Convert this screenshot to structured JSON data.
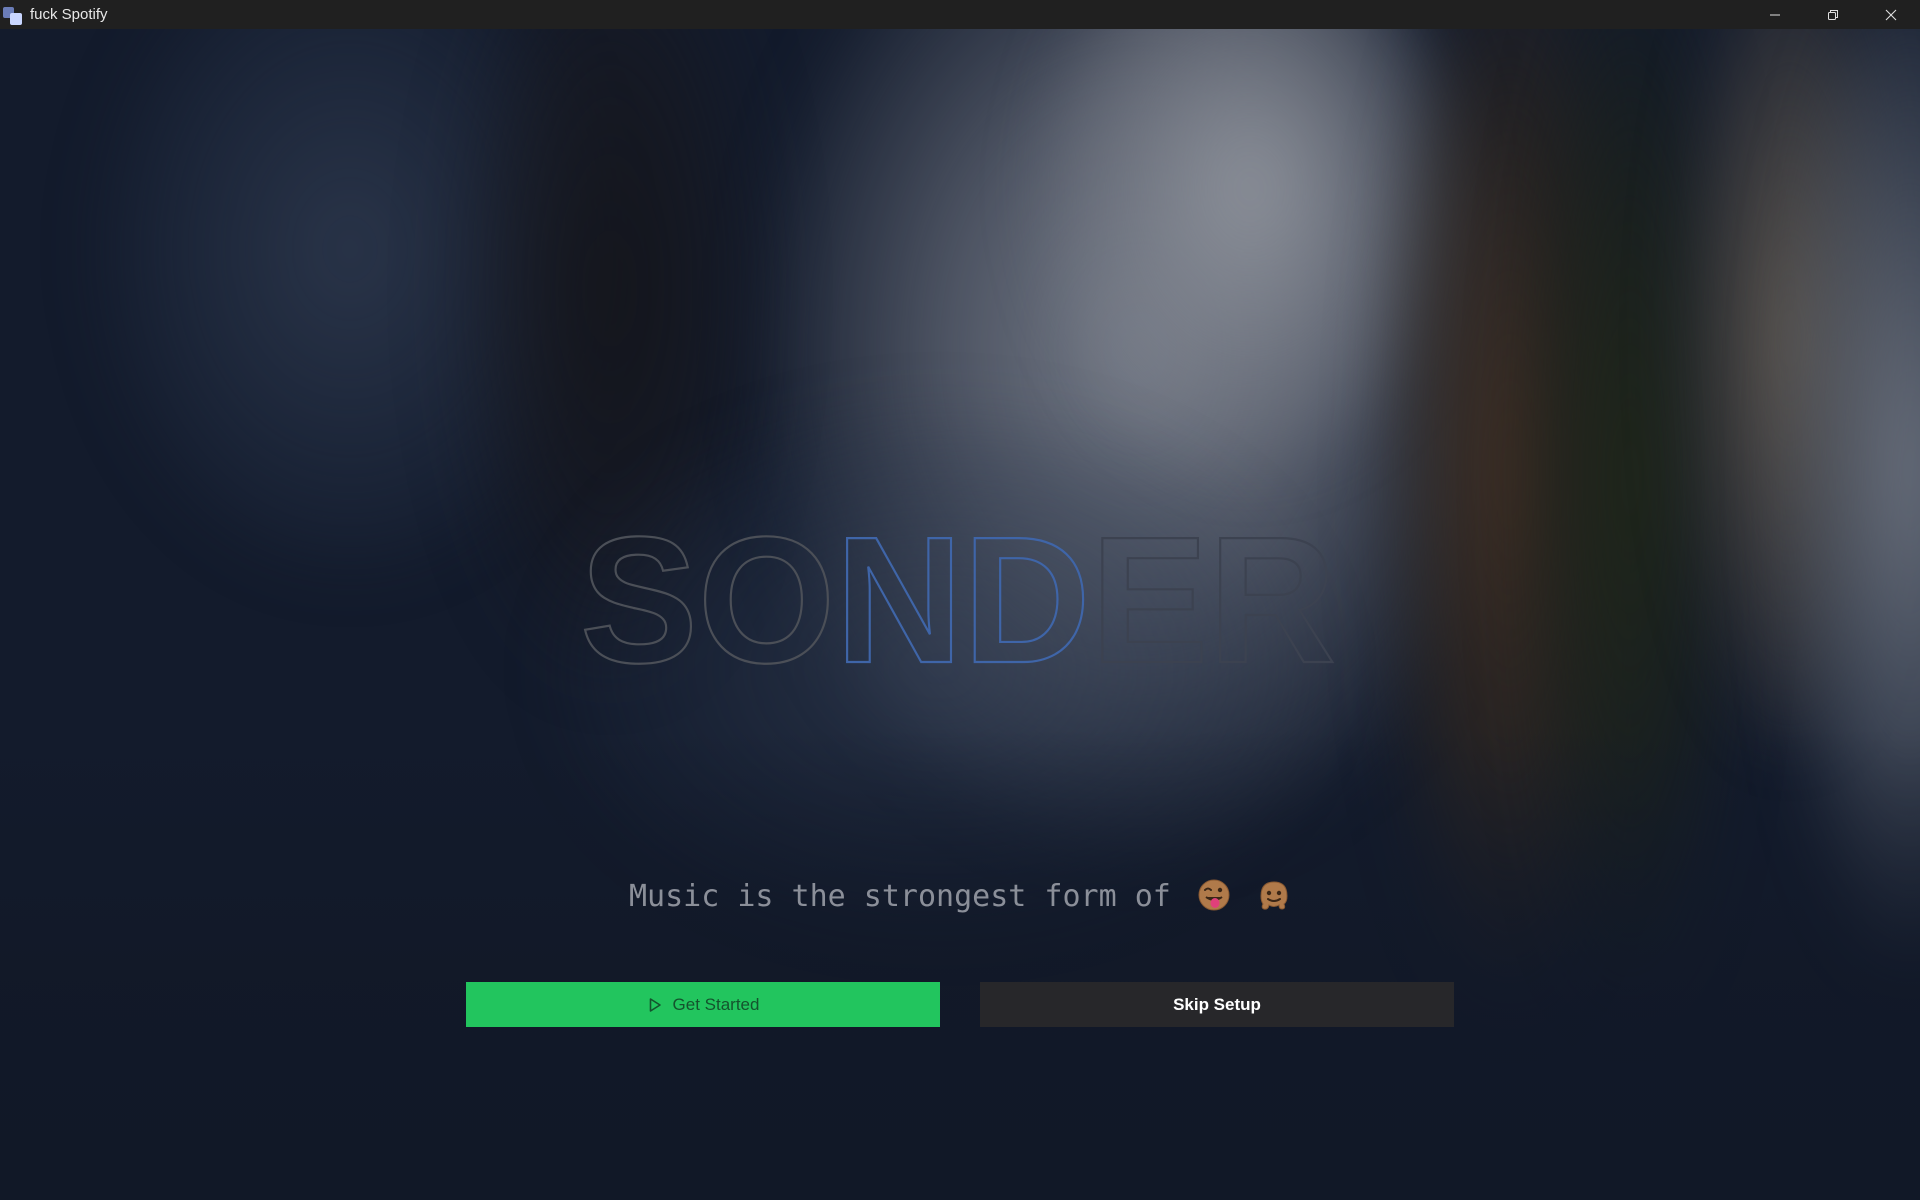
{
  "window": {
    "title": "fuck Spotify",
    "controls": {
      "minimize_icon": "minimize-icon",
      "restore_icon": "restore-icon",
      "close_icon": "close-icon"
    }
  },
  "hero": {
    "logo_letters": [
      "S",
      "O",
      "N",
      "D",
      "E",
      "R"
    ],
    "logo_colors": {
      "S": "#4b4f57",
      "O": "#4b4f57",
      "N": "#3f65a8",
      "D": "#3f65a8",
      "E": "#3c4250",
      "R": "#3c4250"
    },
    "tagline": "Music is the strongest form of",
    "tagline_emojis": [
      "winking-face-with-tongue-icon",
      "melting-face-icon"
    ]
  },
  "actions": {
    "get_started_label": "Get Started",
    "get_started_icon": "play-icon",
    "skip_setup_label": "Skip Setup"
  },
  "colors": {
    "primary_button": "#22c55e",
    "secondary_button": "#27272a",
    "titlebar": "#202020",
    "background": "#111827"
  }
}
